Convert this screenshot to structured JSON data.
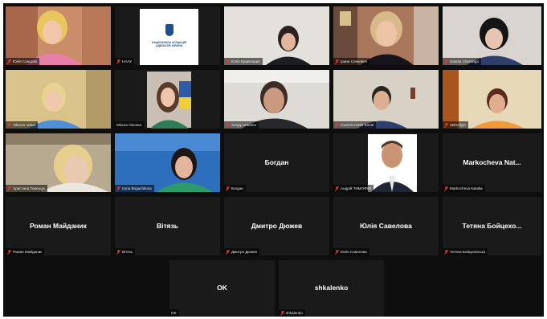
{
  "colors": {
    "background": "#0e0e0e",
    "tile": "#1a1a1a",
    "active_border": "#9dc73b",
    "muted_mic": "#e8382e"
  },
  "tiles": [
    {
      "name": "Юлія Сенцова",
      "big_name": ""
    },
    {
      "name": "НААУ",
      "big_name": "",
      "logo_text": "НАЦІОНАЛЬНА АСОЦІАЦІЯ АДВОКАТІВ УКРАЇНИ"
    },
    {
      "name": "Юлія Кравчишин",
      "big_name": ""
    },
    {
      "name": "Ірина Сенкевич",
      "big_name": ""
    },
    {
      "name": "Natalia Chernega",
      "big_name": ""
    },
    {
      "name": "Viktoria Vakar",
      "big_name": ""
    },
    {
      "name": "Місько Оксана",
      "big_name": ""
    },
    {
      "name": "Sergiy Antonov",
      "big_name": ""
    },
    {
      "name": "OLEKSANDR Koval",
      "big_name": ""
    },
    {
      "name": "ЗИНАЇДА",
      "big_name": ""
    },
    {
      "name": "Христина Терещук",
      "big_name": ""
    },
    {
      "name": "Iryna Bogachkova",
      "big_name": ""
    },
    {
      "name": "Богдан",
      "big_name": "Богдан"
    },
    {
      "name": "Андрій ТИМОФІЇВ",
      "big_name": ""
    },
    {
      "name": "Markocheva Natalia",
      "big_name": "Markocheva Nat..."
    },
    {
      "name": "Роман Майданик",
      "big_name": "Роман Майданик"
    },
    {
      "name": "Вітязь",
      "big_name": "Вітязь"
    },
    {
      "name": "Дмитро Дюжев",
      "big_name": "Дмитро Дюжев"
    },
    {
      "name": "Юлія Савелова",
      "big_name": "Юлія Савелова"
    },
    {
      "name": "Тетяна Бойцехівська",
      "big_name": "Тетяна Бойцехо..."
    },
    {
      "name": "OK",
      "big_name": "OK"
    },
    {
      "name": "shkalenko",
      "big_name": "shkalenko"
    }
  ]
}
